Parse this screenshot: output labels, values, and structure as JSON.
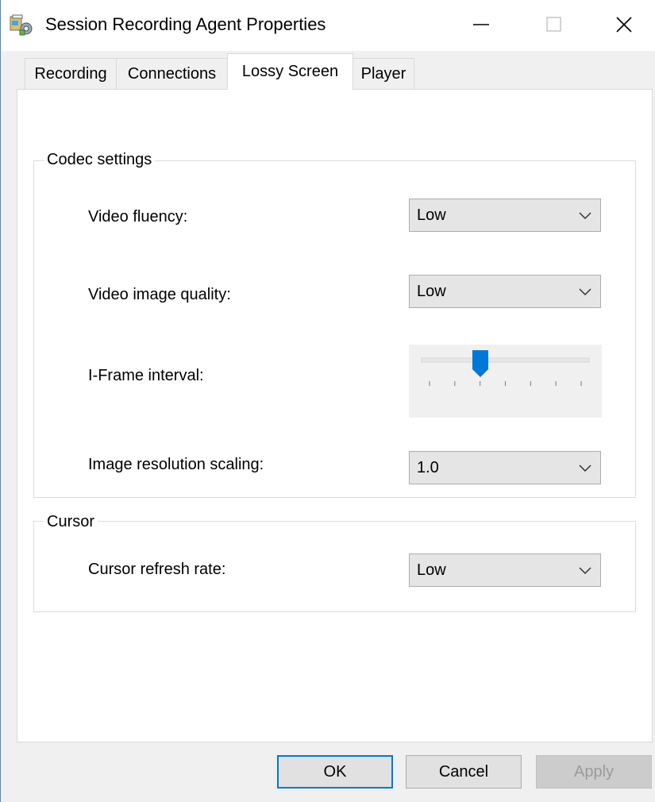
{
  "window": {
    "title": "Session Recording Agent Properties",
    "icon": "session-recording-app-icon",
    "controls": {
      "minimize": "—",
      "maximize": "□",
      "close": "✕"
    }
  },
  "tabs": [
    {
      "label": "Recording",
      "selected": false
    },
    {
      "label": "Connections",
      "selected": false
    },
    {
      "label": "Lossy Screen",
      "selected": true
    },
    {
      "label": "Player",
      "selected": false
    }
  ],
  "codec": {
    "title": "Codec settings",
    "video_fluency": {
      "label": "Video fluency:",
      "value": "Low"
    },
    "video_image_quality": {
      "label": "Video image quality:",
      "value": "Low"
    },
    "iframe_interval": {
      "label": "I-Frame interval:",
      "position": 2,
      "tick_count": 7
    },
    "image_resolution_scaling": {
      "label": "Image resolution scaling:",
      "value": "1.0"
    }
  },
  "cursor": {
    "title": "Cursor",
    "refresh_rate": {
      "label": "Cursor refresh rate:",
      "value": "Low"
    }
  },
  "buttons": {
    "ok": "OK",
    "cancel": "Cancel",
    "apply": "Apply"
  },
  "colors": {
    "accent": "#0078d7",
    "window_border": "#4a86d4"
  }
}
